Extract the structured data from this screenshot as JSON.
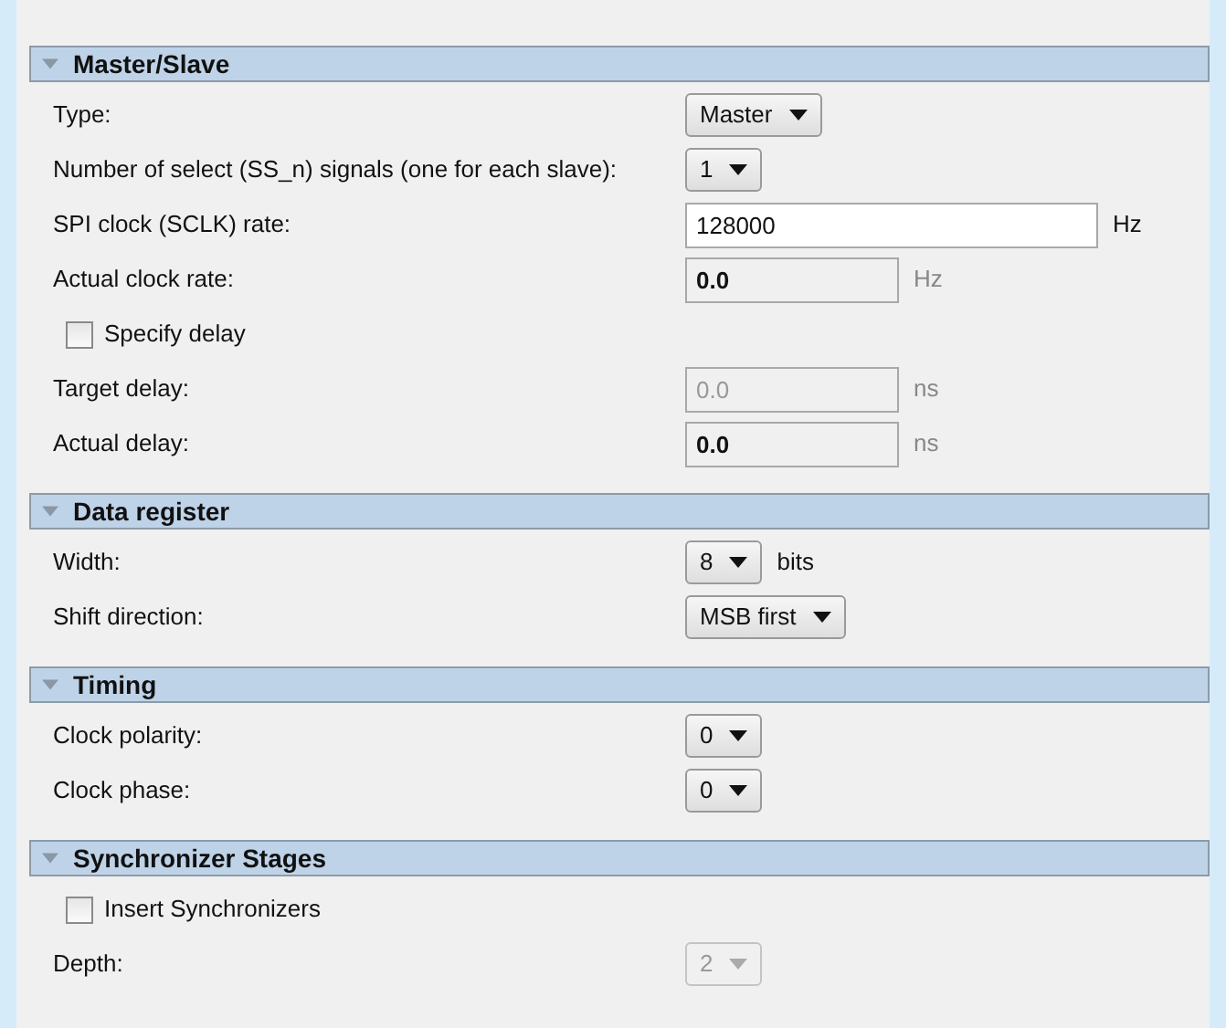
{
  "sections": [
    {
      "title": "Master/Slave",
      "expanded": true,
      "rows": [
        {
          "kind": "dropdown",
          "label": "Type:",
          "value": "Master",
          "disabled": false
        },
        {
          "kind": "dropdown",
          "label": "Number of select (SS_n) signals (one for each slave):",
          "value": "1",
          "disabled": false
        },
        {
          "kind": "text",
          "label": "SPI clock (SCLK) rate:",
          "value": "128000",
          "unit": "Hz",
          "editable": true,
          "disabled": false
        },
        {
          "kind": "text",
          "label": "Actual clock rate:",
          "value": "0.0",
          "unit": "Hz",
          "editable": false,
          "disabled": false
        },
        {
          "kind": "checkbox",
          "label": "Specify delay",
          "checked": false
        },
        {
          "kind": "text",
          "label": "Target delay:",
          "value": "0.0",
          "unit": "ns",
          "editable": false,
          "disabled": true
        },
        {
          "kind": "text",
          "label": "Actual delay:",
          "value": "0.0",
          "unit": "ns",
          "editable": false,
          "disabled": false
        }
      ]
    },
    {
      "title": "Data register",
      "expanded": true,
      "rows": [
        {
          "kind": "dropdown",
          "label": "Width:",
          "value": "8",
          "unit": "bits",
          "disabled": false
        },
        {
          "kind": "dropdown",
          "label": "Shift direction:",
          "value": "MSB first",
          "disabled": false
        }
      ]
    },
    {
      "title": "Timing",
      "expanded": true,
      "rows": [
        {
          "kind": "dropdown",
          "label": "Clock polarity:",
          "value": "0",
          "disabled": false
        },
        {
          "kind": "dropdown",
          "label": "Clock phase:",
          "value": "0",
          "disabled": false
        }
      ]
    },
    {
      "title": "Synchronizer Stages",
      "expanded": true,
      "rows": [
        {
          "kind": "checkbox",
          "label": "Insert Synchronizers",
          "checked": false
        },
        {
          "kind": "dropdown",
          "label": "Depth:",
          "value": "2",
          "disabled": true
        }
      ]
    }
  ]
}
